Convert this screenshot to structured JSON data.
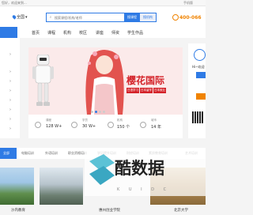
{
  "topbar": {
    "left_text": "您好，欢迎来到...",
    "right_text": "手机版"
  },
  "header": {
    "location": "全国",
    "search_placeholder": "搜索课程/机构/老师",
    "search_button": "搜课程",
    "search_button2": "搜机构",
    "phone": "400-066"
  },
  "nav": {
    "items": [
      "首页",
      "课程",
      "机构",
      "校区",
      "讲座",
      "师资",
      "学生作品"
    ]
  },
  "banner": {
    "title": "樱花国际",
    "tags": [
      "日语学习",
      "日本留学",
      "日本就业"
    ]
  },
  "right_panel": {
    "greeting": "Hi~欢迎"
  },
  "stats": [
    {
      "label": "课程",
      "value": "128 W+"
    },
    {
      "label": "学员",
      "value": "30 W+"
    },
    {
      "label": "机构",
      "value": "150 个"
    },
    {
      "label": "城市",
      "value": "14 年"
    }
  ],
  "tabs": [
    "全部",
    "电脑培训",
    "外语培训",
    "职业资格培训",
    "学历提升培训",
    "财经培训",
    "素质教育培训",
    "艺术培训"
  ],
  "cards": [
    {
      "caption": "沙内教育"
    },
    {
      "caption": "惠州创业学院"
    },
    {
      "caption": "北京大学"
    }
  ],
  "watermark": {
    "text": "酷数据",
    "sub": "K U I D C"
  },
  "colors": {
    "accent": "#2f7be5",
    "orange": "#f08300",
    "red": "#d4232a"
  }
}
